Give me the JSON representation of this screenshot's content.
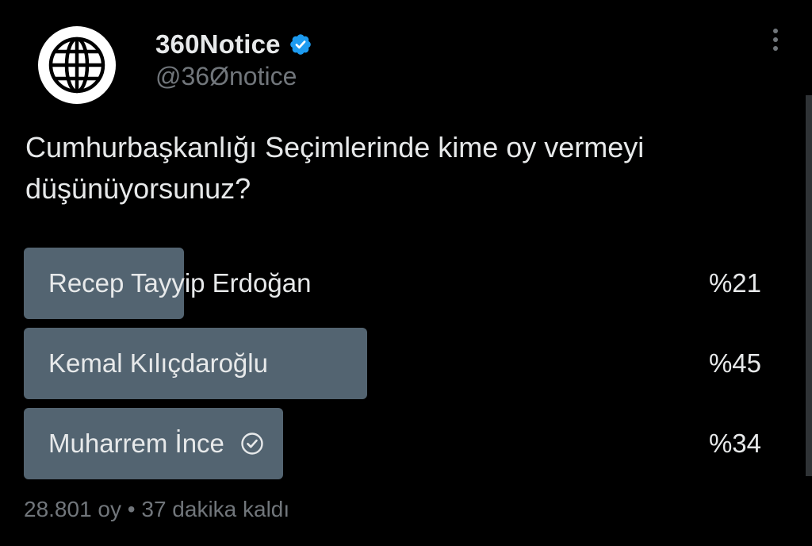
{
  "author": {
    "display_name": "360Notice",
    "handle": "@36Ønotice",
    "verified": true,
    "avatar_icon": "globe-icon",
    "verified_icon": "verified-badge-icon"
  },
  "menu_icon": "more-options-icon",
  "question": "Cumhurbaşkanlığı Seçimlerinde kime oy vermeyi düşünüyorsunuz?",
  "poll": {
    "options": [
      {
        "label": "Recep Tayyip Erdoğan",
        "percent_label": "%21",
        "percent": 21,
        "selected": false
      },
      {
        "label": "Kemal Kılıçdaroğlu",
        "percent_label": "%45",
        "percent": 45,
        "selected": false
      },
      {
        "label": "Muharrem İnce",
        "percent_label": "%34",
        "percent": 34,
        "selected": true
      }
    ],
    "votes": "28.801 oy",
    "separator": "•",
    "time_left": "37 dakika kaldı"
  },
  "colors": {
    "background": "#000000",
    "text_primary": "#e7e9ea",
    "text_secondary": "#71767b",
    "poll_bar": "#536471",
    "verified_blue": "#1d9bf0"
  }
}
